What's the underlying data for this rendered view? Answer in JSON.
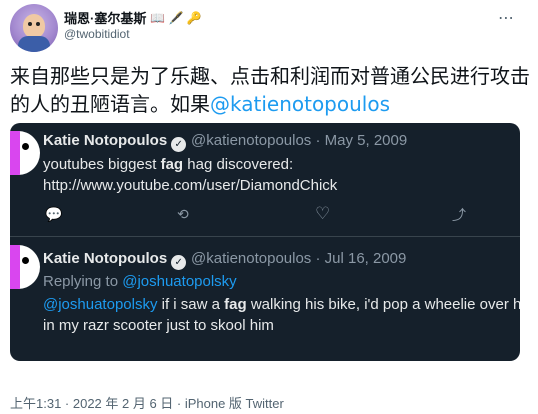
{
  "author": {
    "display_name": "瑞恩·塞尔基斯",
    "name_emojis": "📖 🖋️ 🔑",
    "handle": "@twobitidiot"
  },
  "tweet": {
    "text": "来自那些只是为了乐趣、点击和利润而对普通公民进行攻击的人的丑陋语言。如果",
    "mention": "@katienotopoulos"
  },
  "quoted": [
    {
      "name": "Katie Notopoulos",
      "handle_date": "@katienotopoulos · May 5, 2009",
      "line1_pre": "youtubes biggest ",
      "line1_bold": "fag",
      "line1_post": " hag discovered:",
      "line2": "http://www.youtube.com/user/DiamondChick"
    },
    {
      "name": "Katie Notopoulos",
      "handle_date": "@katienotopoulos · Jul 16, 2009",
      "replying_prefix": "Replying to ",
      "replying_mention": "@joshuatopolsky",
      "line1_mention": "@joshuatopolsky",
      "line1_pre": " if i saw a ",
      "line1_bold": "fag",
      "line1_post": " walking his bike, i'd pop a wheelie over h",
      "line2": "in my razr scooter just to skool him"
    }
  ],
  "icons": {
    "more": "⋯",
    "reply": "💬",
    "retweet": "⟲",
    "like": "♡",
    "share": "⤴",
    "verified": "✓"
  },
  "footer": "上午1:31 · 2022 年 2 月 6 日 · iPhone 版 Twitter",
  "colors": {
    "card_bg": "#15202b",
    "mention": "#1d9bf0",
    "muted": "#8b98a5"
  }
}
